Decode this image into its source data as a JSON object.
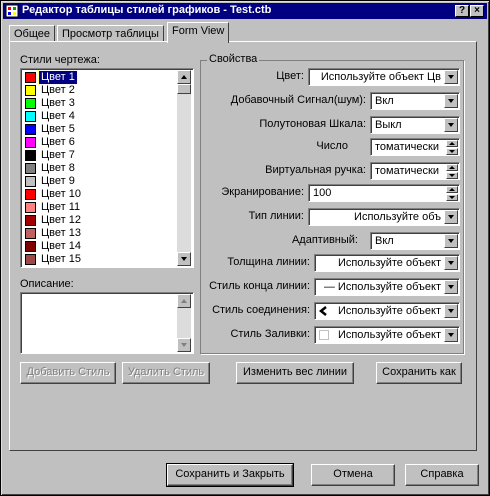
{
  "window": {
    "title": "Редактор таблицы стилей графиков - Test.ctb",
    "help_button": "?",
    "close_button": "×"
  },
  "tabs": [
    {
      "label": "Общее",
      "active": false
    },
    {
      "label": "Просмотр таблицы",
      "active": false
    },
    {
      "label": "Form View",
      "active": true
    }
  ],
  "styles_list": {
    "label": "Стили чертежа:",
    "items": [
      {
        "label": "Цвет 1",
        "color": "#ff0000",
        "selected": true
      },
      {
        "label": "Цвет 2",
        "color": "#ffff00"
      },
      {
        "label": "Цвет 3",
        "color": "#00ff00"
      },
      {
        "label": "Цвет 4",
        "color": "#00ffff"
      },
      {
        "label": "Цвет 5",
        "color": "#0000ff"
      },
      {
        "label": "Цвет 6",
        "color": "#ff00ff"
      },
      {
        "label": "Цвет 7",
        "color": "#000000"
      },
      {
        "label": "Цвет 8",
        "color": "#808080"
      },
      {
        "label": "Цвет 9",
        "color": "#c0c0c0"
      },
      {
        "label": "Цвет 10",
        "color": "#ff0000"
      },
      {
        "label": "Цвет 11",
        "color": "#ff8080"
      },
      {
        "label": "Цвет 12",
        "color": "#a00000"
      },
      {
        "label": "Цвет 13",
        "color": "#c06060"
      },
      {
        "label": "Цвет 14",
        "color": "#800000"
      },
      {
        "label": "Цвет 15",
        "color": "#a04848"
      }
    ]
  },
  "description": {
    "label": "Описание:",
    "value": ""
  },
  "properties": {
    "title": "Свойства",
    "color_label": "Цвет:",
    "color_value": "Используйте объект Цв",
    "dither_label": "Добавочный Сигнал(шум):",
    "dither_value": "Вкл",
    "grayscale_label": "Полутоновая Шкала:",
    "grayscale_value": "Выкл",
    "pen_label": "Число",
    "pen_value": "томатически",
    "vpen_label": "Виртуальная ручка:",
    "vpen_value": "томатически",
    "screening_label": "Экранирование:",
    "screening_value": "100",
    "linetype_label": "Тип линии:",
    "linetype_value": "Используйте объ",
    "adaptive_label": "Адаптивный:",
    "adaptive_value": "Вкл",
    "lineweight_label": "Толщина линии:",
    "lineweight_value": "Используйте объект",
    "lineend_label": "Стиль конца линии:",
    "lineend_value": "— Используйте объект",
    "linejoin_label": "Стиль соединения:",
    "linejoin_value": "Используйте объект",
    "fill_label": "Стиль Заливки:",
    "fill_value": "Используйте объект"
  },
  "buttons": {
    "add_style": "Добавить Стиль",
    "delete_style": "Удалить Стиль",
    "edit_lineweights": "Изменить вес линии",
    "save_as": "Сохранить как",
    "save_close": "Сохранить и Закрыть",
    "cancel": "Отмена",
    "help": "Справка"
  },
  "colors": {
    "titlebar": "#000080",
    "face": "#c0c0c0",
    "selection": "#000080"
  }
}
